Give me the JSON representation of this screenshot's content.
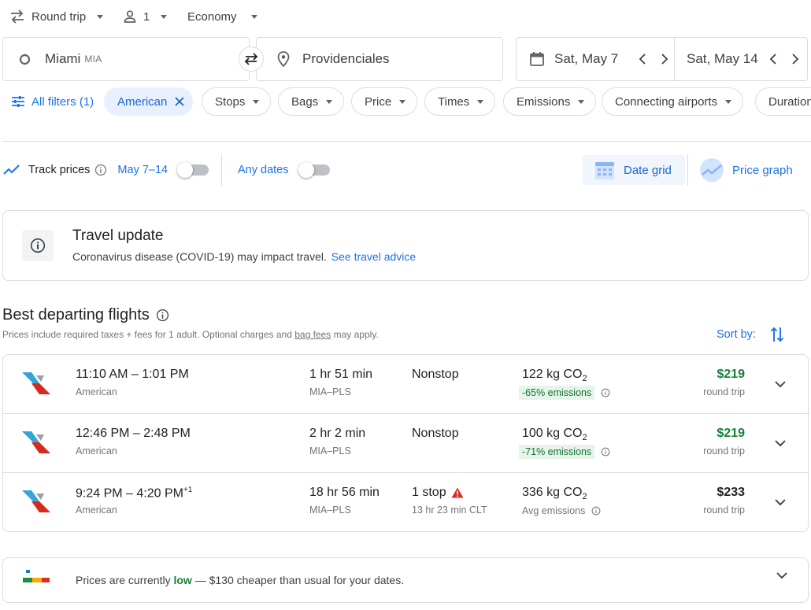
{
  "top_controls": {
    "trip_type": "Round trip",
    "passengers": "1",
    "cabin_class": "Economy"
  },
  "search": {
    "origin_city": "Miami",
    "origin_code": "MIA",
    "destination": "Providenciales",
    "depart_date": "Sat, May 7",
    "return_date": "Sat, May 14"
  },
  "filters": {
    "all_filters": "All filters (1)",
    "active_filter": "American",
    "chips": [
      "Stops",
      "Bags",
      "Price",
      "Times",
      "Emissions",
      "Connecting airports",
      "Duration"
    ]
  },
  "tracking": {
    "track_prices": "Track prices",
    "date_range": "May 7–14",
    "any_dates": "Any dates",
    "date_grid": "Date grid",
    "price_graph": "Price graph"
  },
  "travel_update": {
    "title": "Travel update",
    "body": "Coronavirus disease (COVID-19) may impact travel.",
    "link": "See travel advice"
  },
  "results": {
    "heading": "Best departing flights",
    "note_before": "Prices include required taxes + fees for 1 adult. Optional charges and",
    "note_link": "bag fees",
    "note_after": "may apply.",
    "sort_label": "Sort by:"
  },
  "flights": [
    {
      "time_range": "11:10 AM – 1:01 PM",
      "plus_day": "",
      "airline": "American",
      "duration": "1 hr 51 min",
      "route": "MIA–PLS",
      "stops": "Nonstop",
      "layover": "",
      "co2_value": "122 kg CO",
      "co2_sub": "2",
      "emissions": "-65% emissions",
      "price": "$219",
      "price_note": "round trip"
    },
    {
      "time_range": "12:46 PM – 2:48 PM",
      "plus_day": "",
      "airline": "American",
      "duration": "2 hr 2 min",
      "route": "MIA–PLS",
      "stops": "Nonstop",
      "layover": "",
      "co2_value": "100 kg CO",
      "co2_sub": "2",
      "emissions": "-71% emissions",
      "price": "$219",
      "price_note": "round trip"
    },
    {
      "time_range": "9:24 PM – 4:20 PM",
      "plus_day": "+1",
      "airline": "American",
      "duration": "18 hr 56 min",
      "route": "MIA–PLS",
      "stops": "1 stop",
      "layover": "13 hr 23 min CLT",
      "co2_value": "336 kg CO",
      "co2_sub": "2",
      "emissions": "Avg emissions",
      "price": "$233",
      "price_note": "round trip"
    }
  ],
  "price_insight": {
    "before": "Prices are currently",
    "level": "low",
    "after": "— $130 cheaper than usual for your dates."
  },
  "colors": {
    "accent_blue": "#1a73e8",
    "price_green": "#188038",
    "chip_active_bg": "#e8f0fe",
    "warning_red": "#d93025",
    "aa_blue": "#36a3d9",
    "aa_red": "#d52b1e"
  },
  "icons": [
    "swap-arrows-icon",
    "person-icon",
    "circle-origin-icon",
    "location-pin-icon",
    "swap-icon",
    "calendar-icon",
    "chevron-left-icon",
    "chevron-right-icon",
    "filter-sliders-icon",
    "close-icon",
    "trend-line-icon",
    "info-icon",
    "date-grid-icon",
    "price-graph-icon",
    "sort-arrows-icon",
    "american-airlines-logo",
    "warning-icon",
    "chevron-down-icon",
    "price-level-icon"
  ]
}
